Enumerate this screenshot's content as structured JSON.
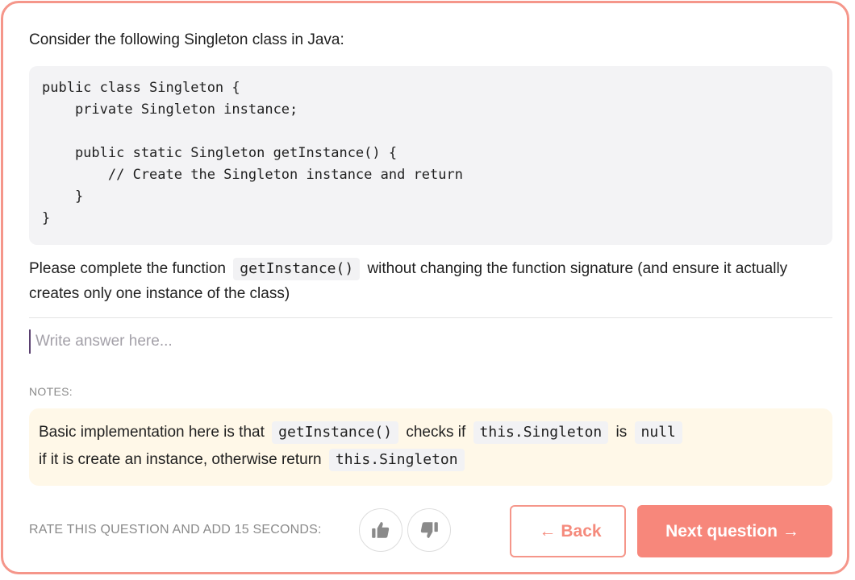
{
  "question": {
    "intro": "Consider the following Singleton class in Java:",
    "code_lines": [
      "public class Singleton {",
      "    private Singleton instance;",
      "",
      "    public static Singleton getInstance() {",
      "        // Create the Singleton instance and return",
      "    }",
      "}"
    ],
    "prompt_before": "Please complete the function",
    "prompt_code": "getInstance()",
    "prompt_after": "without changing the function signature (and ensure it actually creates only one instance of the class)"
  },
  "answer": {
    "value": "",
    "placeholder": "Write answer here..."
  },
  "notes": {
    "label": "NOTES:",
    "line1": {
      "t1": "Basic implementation here is that",
      "c1": "getInstance()",
      "t2": "checks if",
      "c2": "this.Singleton",
      "t3": "is",
      "c3": "null"
    },
    "line2": {
      "t1": "if it is create an instance, otherwise return",
      "c1": "this.Singleton"
    }
  },
  "footer": {
    "rate_label": "RATE THIS QUESTION AND ADD 15 SECONDS:",
    "thumbs_up_icon": "thumbs-up-icon",
    "thumbs_down_icon": "thumbs-down-icon",
    "back_arrow": "←",
    "back_label": "Back",
    "next_label": "Next question",
    "next_arrow": "→"
  },
  "colors": {
    "accent": "#f7877b",
    "border": "#f5968a",
    "code_bg": "#f3f3f5",
    "notes_bg": "#fff8e8"
  }
}
